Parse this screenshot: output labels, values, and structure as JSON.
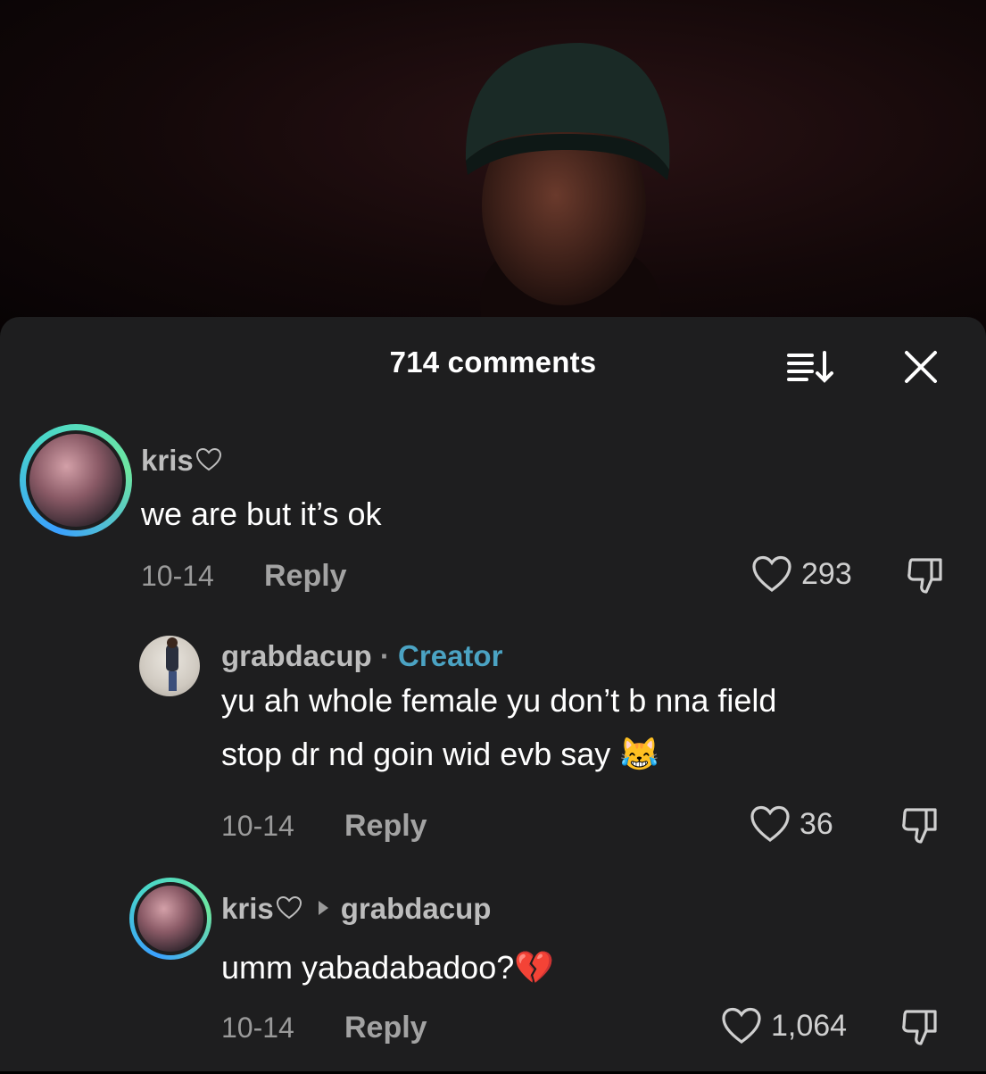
{
  "sheet": {
    "title": "714 comments"
  },
  "comments": [
    {
      "username": "kris",
      "text": "we are but it’s ok",
      "date": "10-14",
      "reply": "Reply",
      "likes": "293"
    },
    {
      "username": "grabdacup",
      "separator": "·",
      "badge": "Creator",
      "lines": [
        "yu ah whole female yu don’t b nna field",
        "stop dr nd goin wid evb say"
      ],
      "emoji": "😹",
      "date": "10-14",
      "reply": "Reply",
      "likes": "36"
    },
    {
      "username": "kris",
      "reply_to": "grabdacup",
      "text": "umm yabadabadoo?",
      "emoji": "💔",
      "date": "10-14",
      "reply": "Reply",
      "likes": "1,064"
    }
  ],
  "icons": {
    "sort": "sort-icon",
    "close": "close-icon",
    "like": "heart-outline-icon",
    "dislike": "thumbs-down-icon"
  }
}
